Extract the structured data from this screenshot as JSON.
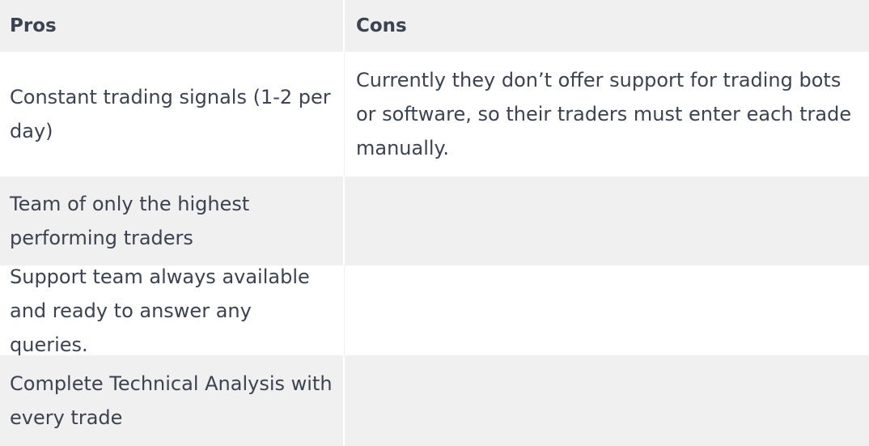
{
  "table": {
    "headers": {
      "pros": "Pros",
      "cons": "Cons"
    },
    "rows": [
      {
        "pro": "Constant trading signals (1-2 per day)",
        "con": "Currently they don’t offer support for trading bots or software, so their traders must enter each trade manually."
      },
      {
        "pro": "Team of only the highest performing traders",
        "con": ""
      },
      {
        "pro_before_link": "Support team always available and ready to answer any ",
        "pro_link": "queries",
        "pro_after_link": ".",
        "con": ""
      },
      {
        "pro": "Complete Technical Analysis with every trade",
        "con": ""
      }
    ]
  }
}
